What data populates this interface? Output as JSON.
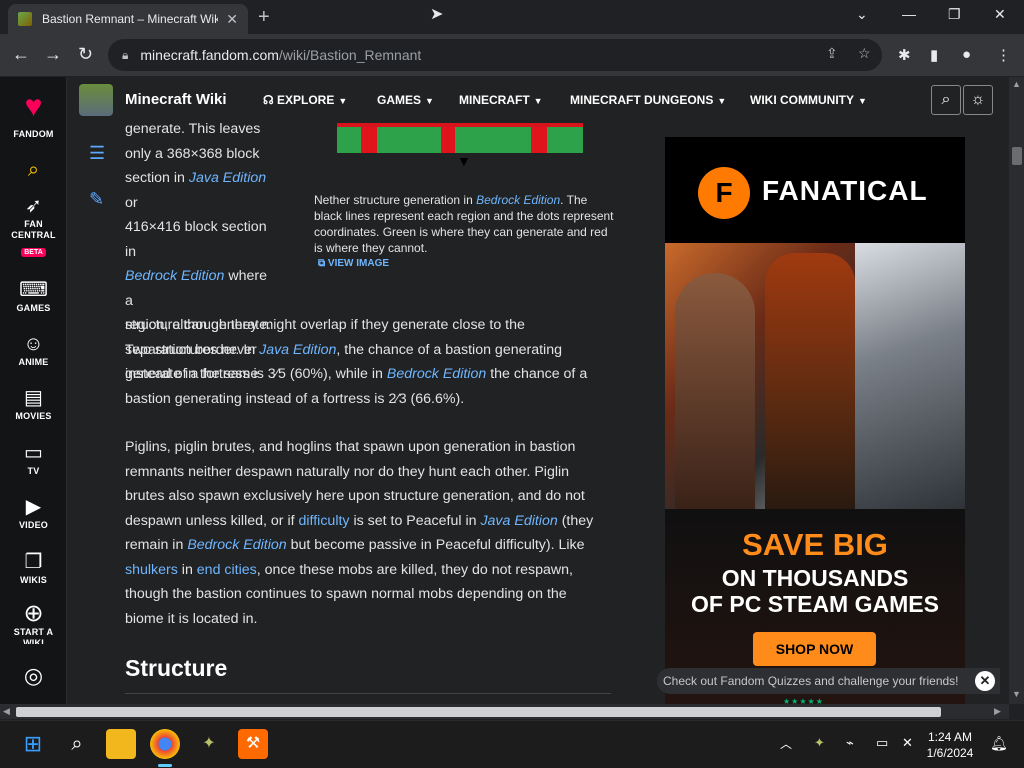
{
  "browser": {
    "tab_title": "Bastion Remnant – Minecraft Wiki",
    "tab_close": "✕",
    "new_tab": "+",
    "url_host": "minecraft.fandom.com",
    "url_path": "/wiki/Bastion_Remnant",
    "window_minimize": "—",
    "window_restore": "❐",
    "window_close": "✕",
    "tab_search": "⌄"
  },
  "rail": {
    "items": [
      {
        "label": "FANDOM"
      },
      {
        "label": "FAN"
      },
      {
        "label": "CENTRAL"
      },
      {
        "label": "BETA"
      },
      {
        "label": "GAMES"
      },
      {
        "label": "ANIME"
      },
      {
        "label": "MOVIES"
      },
      {
        "label": "TV"
      },
      {
        "label": "VIDEO"
      },
      {
        "label": "WIKIS"
      },
      {
        "label": "START A"
      },
      {
        "label": "WIKI"
      }
    ]
  },
  "wiki": {
    "name": "Minecraft Wiki",
    "nav": [
      "EXPLORE",
      "GAMES",
      "MINECRAFT",
      "MINECRAFT DUNGEONS",
      "WIKI COMMUNITY"
    ]
  },
  "article": {
    "p1_lines": [
      "generate. This leaves",
      "only a 368×368 block",
      "section in",
      "416×416 block section in",
      "where a",
      "structure can generate.",
      "Two structures never",
      "generate in the same"
    ],
    "java": "Java Edition",
    "bedrock": "Bedrock Edition",
    "or": "or",
    "p1_full_1": "region, although they might overlap if they generate close to the",
    "p1_full_2a": "separation border. In",
    "p1_full_2b": ", the chance of a bastion generating",
    "p1_full_3a": "instead of a fortress is",
    "frac1": "3⁄5",
    "p1_full_3b": "(60%), while in",
    "p1_full_3c": "the chance of a",
    "p1_full_4a": "bastion generating instead of a fortress is",
    "frac2": "2⁄3",
    "p1_full_4b": "(66.6%).",
    "p2_1": "Piglins, piglin brutes, and hoglins that spawn upon generation in bastion",
    "p2_2": "remnants neither despawn naturally nor do they hunt each other. Piglin",
    "p2_3": "brutes also spawn exclusively here upon structure generation, and do not",
    "p2_4a": "despawn unless killed, or if",
    "difficulty": "difficulty",
    "p2_4b": "is set to Peaceful in",
    "p2_4c": "(they",
    "p2_5a": "remain in",
    "p2_5b": "but become passive in Peaceful difficulty). Like",
    "shulkers": "shulkers",
    "in": "in",
    "end_cities": "end cities",
    "p2_6b": ", once these mobs are killed, they do not respawn,",
    "p2_7": "though the bastion continues to spawn normal mobs depending on the",
    "p2_8": "biome it is located in.",
    "heading": "Structure",
    "caption_1": "Nether structure generation in",
    "caption_2": ". The black lines represent each region and the dots represent coordinates. Green is where they can generate and red is where they cannot.",
    "view_image": "VIEW IMAGE"
  },
  "ad": {
    "brand": "FANATICAL",
    "logo_letter": "F",
    "save": "SAVE BIG",
    "line2": "ON THOUSANDS",
    "line3": "OF PC STEAM GAMES",
    "cta": "SHOP NOW",
    "stars": "★★★★★"
  },
  "quiz": {
    "text": "Check out Fandom Quizzes and challenge your friends!",
    "close": "✕"
  },
  "taskbar": {
    "time": "1:24 AM",
    "date": "1/6/2024"
  },
  "colors": {
    "fandom_accent": "#fa005a",
    "link": "#6fb6ff",
    "ad_orange": "#ff8c1a"
  }
}
